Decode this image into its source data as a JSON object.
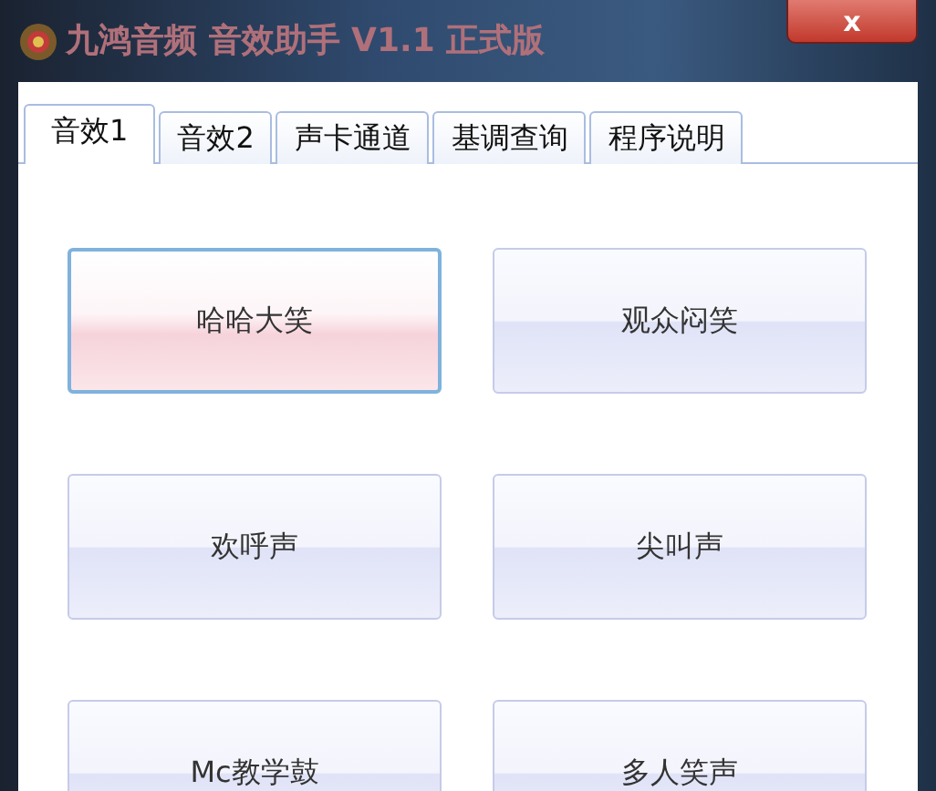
{
  "window": {
    "title": "九鸿音频 音效助手 V1.1 正式版",
    "close": "x"
  },
  "tabs": [
    {
      "label": "音效1",
      "selected": true
    },
    {
      "label": "音效2",
      "selected": false
    },
    {
      "label": "声卡通道",
      "selected": false
    },
    {
      "label": "基调查询",
      "selected": false
    },
    {
      "label": "程序说明",
      "selected": false
    }
  ],
  "buttons": [
    {
      "label": "哈哈大笑",
      "focused": true
    },
    {
      "label": "观众闷笑",
      "focused": false
    },
    {
      "label": "欢呼声",
      "focused": false
    },
    {
      "label": "尖叫声",
      "focused": false
    },
    {
      "label": "Mc教学鼓",
      "focused": false
    },
    {
      "label": "多人笑声",
      "focused": false
    }
  ]
}
